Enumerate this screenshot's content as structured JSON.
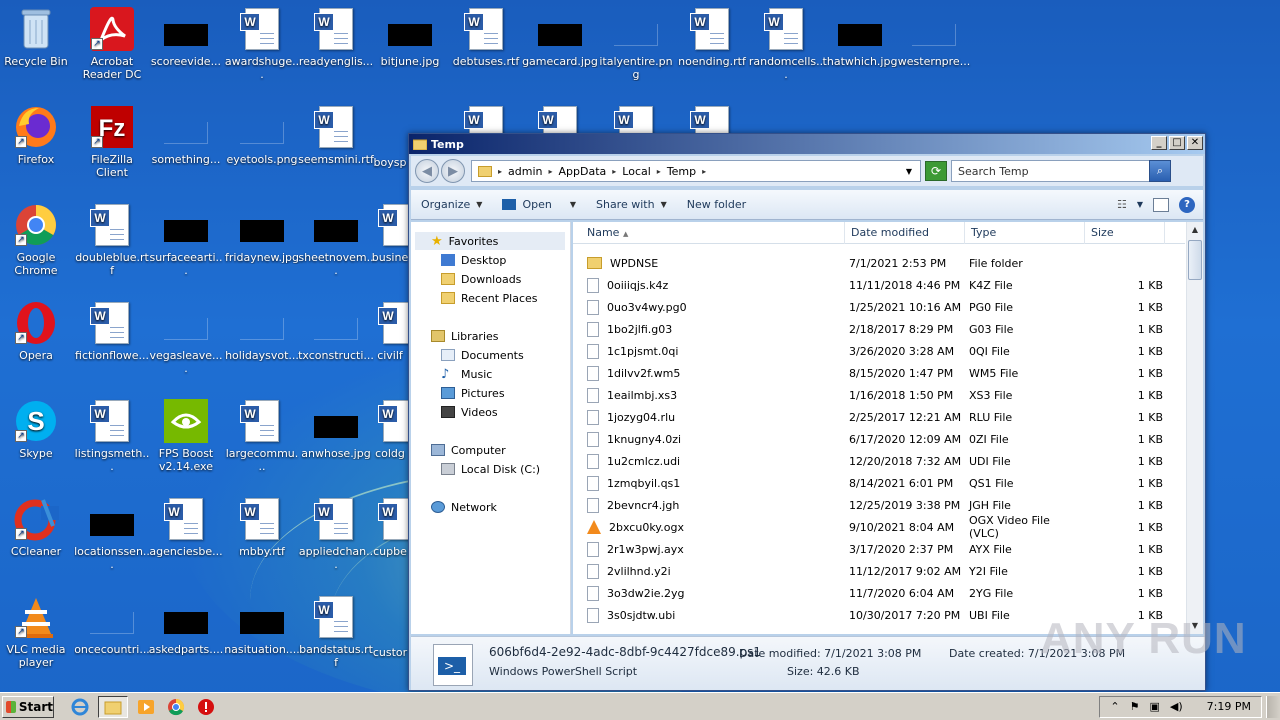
{
  "desktop": {
    "icons": [
      {
        "id": "recycle",
        "label": "Recycle Bin"
      },
      {
        "id": "acrobat",
        "label": "Acrobat Reader DC"
      },
      {
        "id": "scoreevide",
        "label": "scoreevide..."
      },
      {
        "id": "awardshuge",
        "label": "awardshuge..."
      },
      {
        "id": "readyenglis",
        "label": "readyenglis..."
      },
      {
        "id": "bitjune",
        "label": "bitjune.jpg"
      },
      {
        "id": "debtuses",
        "label": "debtuses.rtf"
      },
      {
        "id": "gamecard",
        "label": "gamecard.jpg"
      },
      {
        "id": "italyentire",
        "label": "italyentire.png"
      },
      {
        "id": "noending",
        "label": "noending.rtf"
      },
      {
        "id": "randomcells",
        "label": "randomcells..."
      },
      {
        "id": "thatwhich",
        "label": "thatwhich.jpg"
      },
      {
        "id": "westernpre",
        "label": "westernpre..."
      },
      {
        "id": "firefox",
        "label": "Firefox"
      },
      {
        "id": "filezilla",
        "label": "FileZilla Client"
      },
      {
        "id": "something",
        "label": "something..."
      },
      {
        "id": "eyetools",
        "label": "eyetools.png"
      },
      {
        "id": "seemsmini",
        "label": "seemsmini.rtf"
      },
      {
        "id": "boysp",
        "label": "boysp"
      },
      {
        "id": "chrome",
        "label": "Google Chrome"
      },
      {
        "id": "doubleblue",
        "label": "doubleblue.rtf"
      },
      {
        "id": "surfaceearti",
        "label": "surfaceearti..."
      },
      {
        "id": "fridaynew",
        "label": "fridaynew.jpg"
      },
      {
        "id": "sheetnovem",
        "label": "sheetnovem..."
      },
      {
        "id": "busine",
        "label": "busine"
      },
      {
        "id": "opera",
        "label": "Opera"
      },
      {
        "id": "fictionflowe",
        "label": "fictionflowe..."
      },
      {
        "id": "vegasleave",
        "label": "vegasleave...."
      },
      {
        "id": "holidaysvot",
        "label": "holidaysvot..."
      },
      {
        "id": "txconstruct",
        "label": "txconstructi..."
      },
      {
        "id": "civilf",
        "label": "civilf"
      },
      {
        "id": "skype",
        "label": "Skype"
      },
      {
        "id": "listingsmeth",
        "label": "listingsmeth..."
      },
      {
        "id": "fpsboost",
        "label": "FPS Boost v2.14.exe"
      },
      {
        "id": "largecommu",
        "label": "largecommu..."
      },
      {
        "id": "anwhose",
        "label": "anwhose.jpg"
      },
      {
        "id": "coldg",
        "label": "coldg"
      },
      {
        "id": "ccleaner",
        "label": "CCleaner"
      },
      {
        "id": "locationssen",
        "label": "locationssen..."
      },
      {
        "id": "agenciesbe",
        "label": "agenciesbe..."
      },
      {
        "id": "mbby",
        "label": "mbby.rtf"
      },
      {
        "id": "appliedchan",
        "label": "appliedchan..."
      },
      {
        "id": "cupbe",
        "label": "cupbe"
      },
      {
        "id": "vlc",
        "label": "VLC media player"
      },
      {
        "id": "oncecountri",
        "label": "oncecountri..."
      },
      {
        "id": "askedparts",
        "label": "askedparts...."
      },
      {
        "id": "nasituation",
        "label": "nasituation...."
      },
      {
        "id": "bandstatus",
        "label": "bandstatus.rtf"
      },
      {
        "id": "custor",
        "label": "custor"
      }
    ]
  },
  "window": {
    "title": "Temp",
    "address": [
      "admin",
      "AppData",
      "Local",
      "Temp"
    ],
    "search_placeholder": "Search Temp",
    "toolbar": {
      "organize": "Organize",
      "open": "Open",
      "share": "Share with",
      "new_folder": "New folder"
    },
    "nav": {
      "favorites": "Favorites",
      "desktop": "Desktop",
      "downloads": "Downloads",
      "recent": "Recent Places",
      "libraries": "Libraries",
      "documents": "Documents",
      "music": "Music",
      "pictures": "Pictures",
      "videos": "Videos",
      "computer": "Computer",
      "localdisk": "Local Disk (C:)",
      "network": "Network"
    },
    "columns": {
      "name": "Name",
      "date": "Date modified",
      "type": "Type",
      "size": "Size"
    },
    "files": [
      {
        "name": "WPDNSE",
        "date": "7/1/2021 2:53 PM",
        "type": "File folder",
        "size": "",
        "kind": "folder"
      },
      {
        "name": "0oiiiqjs.k4z",
        "date": "11/11/2018 4:46 PM",
        "type": "K4Z File",
        "size": "1 KB",
        "kind": "file"
      },
      {
        "name": "0uo3v4wy.pg0",
        "date": "1/25/2021 10:16 AM",
        "type": "PG0 File",
        "size": "1 KB",
        "kind": "file"
      },
      {
        "name": "1bo2jlfi.g03",
        "date": "2/18/2017 8:29 PM",
        "type": "G03 File",
        "size": "1 KB",
        "kind": "file"
      },
      {
        "name": "1c1pjsmt.0qi",
        "date": "3/26/2020 3:28 AM",
        "type": "0QI File",
        "size": "1 KB",
        "kind": "file"
      },
      {
        "name": "1dilvv2f.wm5",
        "date": "8/15/2020 1:47 PM",
        "type": "WM5 File",
        "size": "1 KB",
        "kind": "file"
      },
      {
        "name": "1eailmbj.xs3",
        "date": "1/16/2018 1:50 PM",
        "type": "XS3 File",
        "size": "1 KB",
        "kind": "file"
      },
      {
        "name": "1jozyg04.rlu",
        "date": "2/25/2017 12:21 AM",
        "type": "RLU File",
        "size": "1 KB",
        "kind": "file"
      },
      {
        "name": "1knugny4.0zi",
        "date": "6/17/2020 12:09 AM",
        "type": "0ZI File",
        "size": "1 KB",
        "kind": "file"
      },
      {
        "name": "1u2cmlcz.udi",
        "date": "12/20/2018 7:32 AM",
        "type": "UDI File",
        "size": "1 KB",
        "kind": "file"
      },
      {
        "name": "1zmqbyil.qs1",
        "date": "8/14/2021 6:01 PM",
        "type": "QS1 File",
        "size": "1 KB",
        "kind": "file"
      },
      {
        "name": "2bevncr4.jgh",
        "date": "12/25/2019 3:38 PM",
        "type": "JGH File",
        "size": "1 KB",
        "kind": "file"
      },
      {
        "name": "2bxcu0ky.ogx",
        "date": "9/10/2021 8:04 AM",
        "type": "OGX Video File (VLC)",
        "size": "1 KB",
        "kind": "vlc"
      },
      {
        "name": "2r1w3pwj.ayx",
        "date": "3/17/2020 2:37 PM",
        "type": "AYX File",
        "size": "1 KB",
        "kind": "file"
      },
      {
        "name": "2vlilhnd.y2i",
        "date": "11/12/2017 9:02 AM",
        "type": "Y2I File",
        "size": "1 KB",
        "kind": "file"
      },
      {
        "name": "3o3dw2ie.2yg",
        "date": "11/7/2020 6:04 AM",
        "type": "2YG File",
        "size": "1 KB",
        "kind": "file"
      },
      {
        "name": "3s0sjdtw.ubi",
        "date": "10/30/2017 7:20 PM",
        "type": "UBI File",
        "size": "1 KB",
        "kind": "file"
      }
    ],
    "details": {
      "filename": "606bf6d4-2e92-4adc-8dbf-9c4427fdce89.ps1",
      "filetype": "Windows PowerShell Script",
      "modified_label": "Date modified:",
      "modified": "7/1/2021 3:08 PM",
      "created_label": "Date created:",
      "created": "7/1/2021 3:08 PM",
      "size_label": "Size:",
      "size": "42.6 KB"
    }
  },
  "taskbar": {
    "start": "Start",
    "clock": "7:19 PM"
  },
  "watermark": "ANY RUN"
}
